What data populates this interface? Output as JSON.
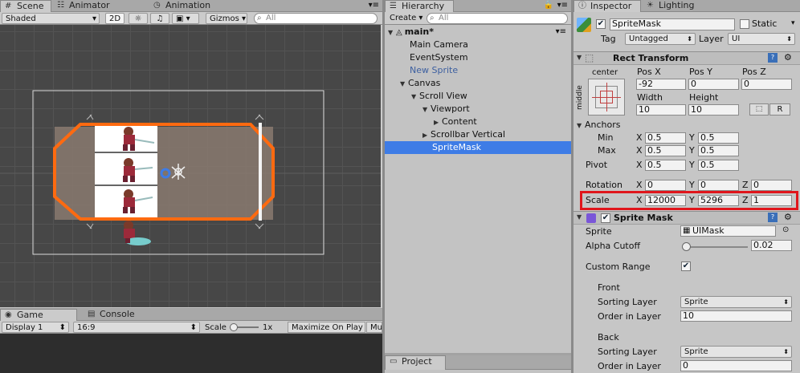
{
  "scene": {
    "tabs": [
      "Scene",
      "Animator",
      "Animation"
    ],
    "toolbar": {
      "shading": "Shaded",
      "mode2d": "2D",
      "gizmos": "Gizmos",
      "search_placeholder": "All"
    }
  },
  "game": {
    "tabs": [
      "Game",
      "Console"
    ],
    "toolbar": {
      "display": "Display 1",
      "aspect": "16:9",
      "scale_label": "Scale",
      "scale_value": "1x",
      "maximize": "Maximize On Play",
      "mute": "Mu"
    }
  },
  "hierarchy": {
    "tab": "Hierarchy",
    "create": "Create",
    "search_placeholder": "All",
    "scene_name": "main*",
    "items": [
      {
        "label": "Main Camera",
        "indent": 0
      },
      {
        "label": "EventSystem",
        "indent": 0
      },
      {
        "label": "New Sprite",
        "indent": 0
      },
      {
        "label": "Canvas",
        "indent": 0
      },
      {
        "label": "Scroll View",
        "indent": 1
      },
      {
        "label": "Viewport",
        "indent": 2
      },
      {
        "label": "Content",
        "indent": 3
      },
      {
        "label": "Scrollbar Vertical",
        "indent": 2
      },
      {
        "label": "SpriteMask",
        "indent": 2
      }
    ]
  },
  "project": {
    "tab": "Project"
  },
  "inspector": {
    "tabs": [
      "Inspector",
      "Lighting"
    ],
    "object_name": "SpriteMask",
    "static_label": "Static",
    "tag_label": "Tag",
    "tag_value": "Untagged",
    "layer_label": "Layer",
    "layer_value": "UI",
    "rect_transform": {
      "title": "Rect Transform",
      "anchor_h": "center",
      "anchor_v": "middle",
      "pos_x_label": "Pos X",
      "pos_y_label": "Pos Y",
      "pos_z_label": "Pos Z",
      "pos_x": "-92",
      "pos_y": "0",
      "pos_z": "0",
      "width_label": "Width",
      "height_label": "Height",
      "width": "10",
      "height": "10",
      "raw_btn": "R",
      "anchors_label": "Anchors",
      "min_label": "Min",
      "min_x": "0.5",
      "min_y": "0.5",
      "max_label": "Max",
      "max_x": "0.5",
      "max_y": "0.5",
      "pivot_label": "Pivot",
      "pivot_x": "0.5",
      "pivot_y": "0.5",
      "rotation_label": "Rotation",
      "rot_x": "0",
      "rot_y": "0",
      "rot_z": "0",
      "scale_label": "Scale",
      "scale_x": "12000",
      "scale_y": "5296",
      "scale_z": "1",
      "x": "X",
      "y": "Y",
      "z": "Z"
    },
    "sprite_mask": {
      "title": "Sprite Mask",
      "sprite_label": "Sprite",
      "sprite_value": "UIMask",
      "alpha_label": "Alpha Cutoff",
      "alpha_value": "0.02",
      "custom_range_label": "Custom Range",
      "front_label": "Front",
      "sorting_layer_label": "Sorting Layer",
      "front_sorting": "Sprite",
      "order_label": "Order in Layer",
      "front_order": "10",
      "back_label": "Back",
      "back_sorting": "Sprite",
      "back_order": "0"
    }
  },
  "colors": {
    "highlight": "#e0161c",
    "selection": "#3e7ce6",
    "mask_outline": "#ff6a10"
  }
}
